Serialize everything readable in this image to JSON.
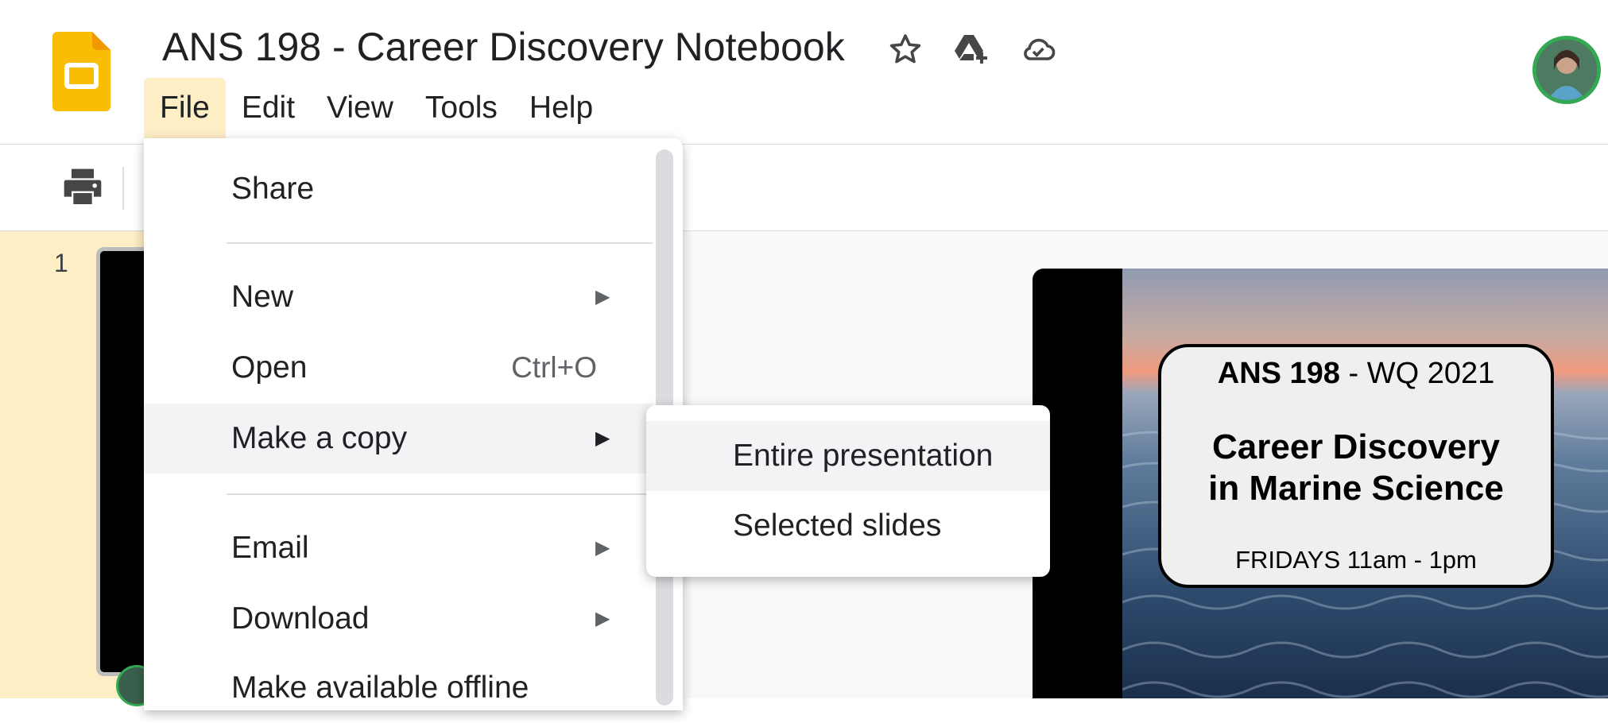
{
  "header": {
    "title": "ANS 198 - Career Discovery Notebook",
    "menus": [
      "File",
      "Edit",
      "View",
      "Tools",
      "Help"
    ],
    "active_menu": "File",
    "icons": [
      "star-icon",
      "move-to-drive-icon",
      "cloud-saved-icon"
    ]
  },
  "filmstrip": {
    "slide_number": "1"
  },
  "file_menu": {
    "items": [
      {
        "label": "Share"
      },
      {
        "label": "New",
        "submenu": true
      },
      {
        "label": "Open",
        "shortcut": "Ctrl+O"
      },
      {
        "label": "Make a copy",
        "submenu": true,
        "highlighted": true
      },
      {
        "label": "Email",
        "submenu": true
      },
      {
        "label": "Download",
        "submenu": true
      },
      {
        "label": "Make available offline"
      }
    ]
  },
  "copy_submenu": {
    "items": [
      {
        "label": "Entire presentation",
        "highlighted": true
      },
      {
        "label": "Selected slides"
      }
    ]
  },
  "slide": {
    "course": "ANS 198",
    "term": " - WQ 2021",
    "title_line1": "Career Discovery",
    "title_line2": "in Marine Science",
    "schedule": "FRIDAYS 11am - 1pm"
  },
  "colors": {
    "accent": "#fbbc04",
    "active_menu_bg": "#fdeec6",
    "hover_bg": "#f1f3f4"
  }
}
